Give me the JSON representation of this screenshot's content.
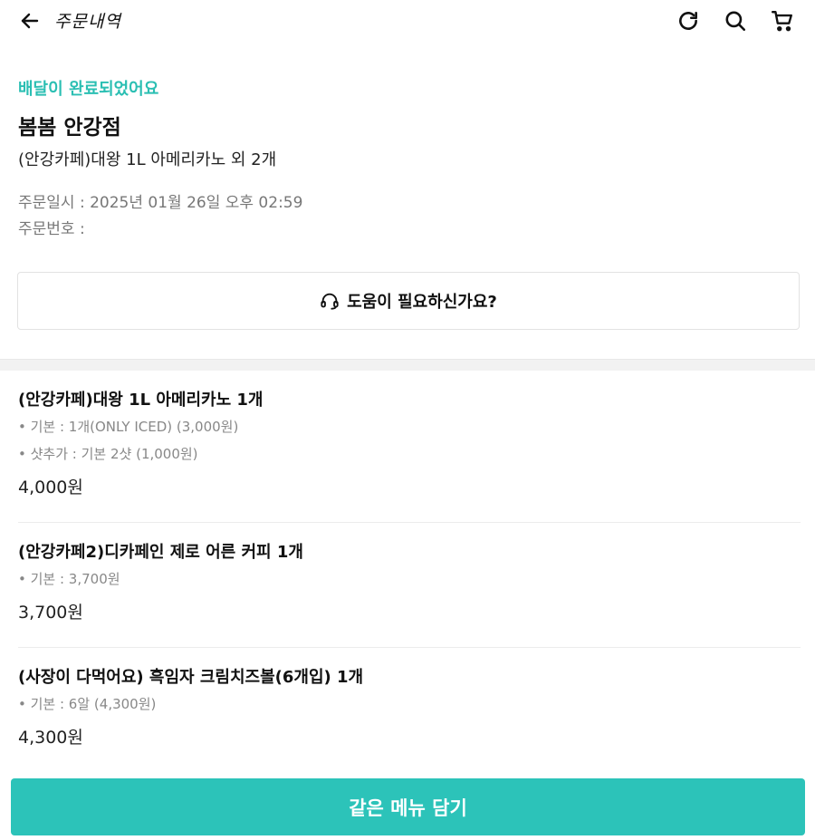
{
  "header": {
    "title": "주문내역",
    "back_icon": "arrow-left-icon",
    "actions": [
      "refresh-icon",
      "search-icon",
      "cart-icon"
    ]
  },
  "summary": {
    "status": "배달이 완료되었어요",
    "store_name": "봄봄 안강점",
    "order_summary": "(안강카페)대왕 1L 아메리카노 외 2개",
    "order_date": "주문일시 : 2025년 01월 26일 오후 02:59",
    "order_number": "주문번호 :"
  },
  "help": {
    "label": "도움이 필요하신가요?",
    "icon": "headset-icon"
  },
  "items": [
    {
      "name": "(안강카페)대왕 1L 아메리카노 1개",
      "options": [
        "• 기본 : 1개(ONLY ICED) (3,000원)",
        "• 샷추가 : 기본 2샷 (1,000원)"
      ],
      "price": "4,000원"
    },
    {
      "name": "(안강카페2)디카페인 제로 어른 커피 1개",
      "options": [
        "• 기본 : 3,700원"
      ],
      "price": "3,700원"
    },
    {
      "name": "(사장이 다먹어요) 흑임자 크림치즈볼(6개입) 1개",
      "options": [
        "• 기본 : 6알 (4,300원)"
      ],
      "price": "4,300원"
    }
  ],
  "cta": {
    "label": "같은 메뉴 담기"
  },
  "colors": {
    "accent": "#2cc3b9",
    "status": "#2bbfb3"
  }
}
